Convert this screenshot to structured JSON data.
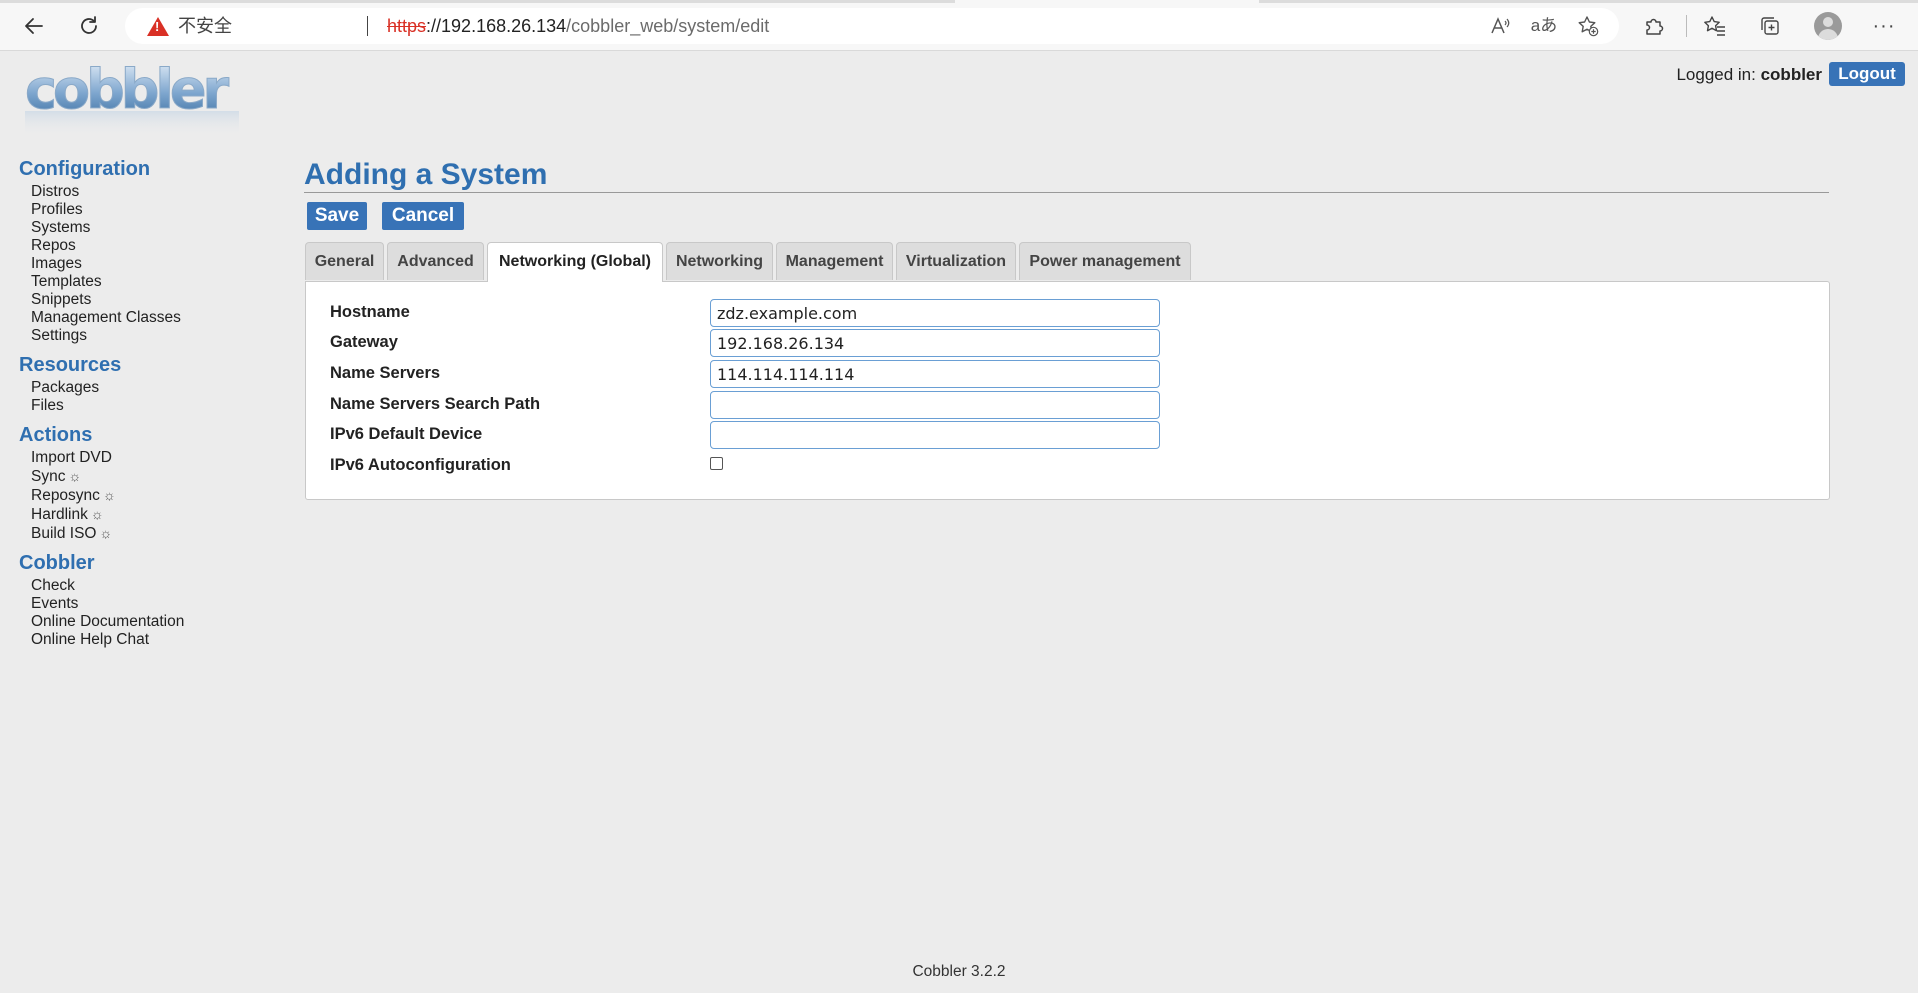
{
  "browser": {
    "insecure_label": "不安全",
    "url": {
      "protocol": "https",
      "host": "://192.168.26.134",
      "path": "/cobbler_web/system/edit"
    },
    "icons": {
      "back": "arrow-left-icon",
      "refresh": "refresh-icon",
      "warning": "warning-triangle-icon",
      "read_aloud": "read-aloud-icon",
      "translate": "translate-icon",
      "add_favorite": "star-plus-icon",
      "extensions": "puzzle-icon",
      "favorites": "favorites-icon",
      "collections": "collections-icon",
      "profile": "profile-avatar-icon",
      "more": "more-dots-icon"
    }
  },
  "header": {
    "logo_text": "cobbler",
    "logged_in_label": "Logged in:",
    "username": "cobbler",
    "logout_label": "Logout"
  },
  "sidebar": {
    "sections": [
      {
        "title": "Configuration",
        "items": [
          "Distros",
          "Profiles",
          "Systems",
          "Repos",
          "Images",
          "Templates",
          "Snippets",
          "Management Classes",
          "Settings"
        ]
      },
      {
        "title": "Resources",
        "items": [
          "Packages",
          "Files"
        ]
      },
      {
        "title": "Actions",
        "items": [
          "Import DVD",
          "Sync",
          "Reposync",
          "Hardlink",
          "Build ISO"
        ]
      },
      {
        "title": "Cobbler",
        "items": [
          "Check",
          "Events",
          "Online Documentation",
          "Online Help Chat"
        ]
      }
    ],
    "gear_glyph": "☼"
  },
  "main": {
    "title": "Adding a System",
    "save_label": "Save",
    "cancel_label": "Cancel",
    "tabs": [
      "General",
      "Advanced",
      "Networking (Global)",
      "Networking",
      "Management",
      "Virtualization",
      "Power management"
    ],
    "active_tab": "Networking (Global)",
    "fields": {
      "hostname": {
        "label": "Hostname",
        "value": "zdz.example.com"
      },
      "gateway": {
        "label": "Gateway",
        "value": "192.168.26.134"
      },
      "name_servers": {
        "label": "Name Servers",
        "value": "114.114.114.114"
      },
      "name_servers_search": {
        "label": "Name Servers Search Path",
        "value": ""
      },
      "ipv6_default_device": {
        "label": "IPv6 Default Device",
        "value": ""
      },
      "ipv6_autoconfig": {
        "label": "IPv6 Autoconfiguration",
        "checked": false
      }
    }
  },
  "footer": {
    "version": "Cobbler 3.2.2"
  },
  "colors": {
    "accent": "#2f6fb0",
    "button": "#3873b7",
    "insecure": "#d93025"
  }
}
